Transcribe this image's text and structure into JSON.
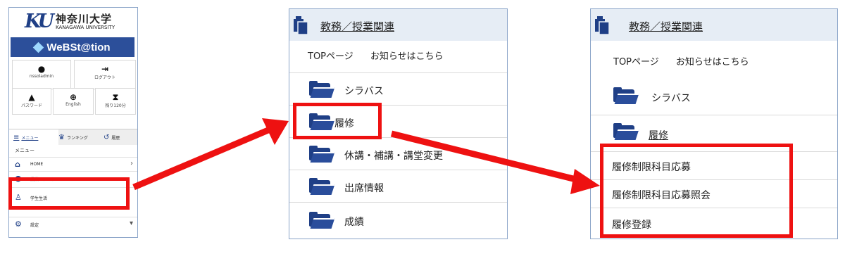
{
  "panel1": {
    "logo": {
      "mark": "KU",
      "jp": "神奈川大学",
      "en": "KANAGAWA UNIVERSITY"
    },
    "brand": "WeBSt@tion",
    "tiles": [
      {
        "icon": "user-icon",
        "glyph": "●",
        "label": "nssoladmin"
      },
      {
        "icon": "logout-icon",
        "glyph": "⇥",
        "label": "ログアウト"
      },
      {
        "icon": "lock-icon",
        "glyph": "▲",
        "label": "パスワード"
      },
      {
        "icon": "globe-icon",
        "glyph": "⊕",
        "label": "English"
      },
      {
        "icon": "hourglass-icon",
        "glyph": "⧗",
        "label": "残り120分"
      }
    ],
    "tabs": [
      {
        "icon": "menu-icon",
        "glyph": "≡",
        "label": "メニュー"
      },
      {
        "icon": "crown-icon",
        "glyph": "♛",
        "label": "ランキング"
      },
      {
        "icon": "history-icon",
        "glyph": "↺",
        "label": "履歴"
      }
    ],
    "menu_heading": "メニュー",
    "menu_items": [
      {
        "icon": "home-icon",
        "glyph": "⌂",
        "label": "HOME",
        "chevron": "›"
      },
      {
        "icon": "survey-icon",
        "glyph": "●",
        "label": "授業・アンケート",
        "chevron": ""
      },
      {
        "icon": "student-icon",
        "glyph": "♙",
        "label": "学生生活",
        "chevron": ""
      },
      {
        "icon": "gear-icon",
        "glyph": "⚙",
        "label": "設定",
        "chevron": "▾"
      }
    ]
  },
  "panel2": {
    "title": "教務／授業関連",
    "links": [
      "TOPページ",
      "お知らせはこちら"
    ],
    "folders": [
      "シラバス",
      "履修",
      "休講・補講・講堂変更",
      "出席情報",
      "成績"
    ]
  },
  "panel3": {
    "title": "教務／授業関連",
    "links": [
      "TOPページ",
      "お知らせはこちら"
    ],
    "folders": [
      "シラバス",
      "履修"
    ],
    "submenu": [
      "履修制限科目応募",
      "履修制限科目応募照会",
      "履修登録"
    ]
  },
  "colors": {
    "accent": "#1f3f86",
    "highlight": "#ee1111",
    "header_bg": "#e6edf5"
  }
}
